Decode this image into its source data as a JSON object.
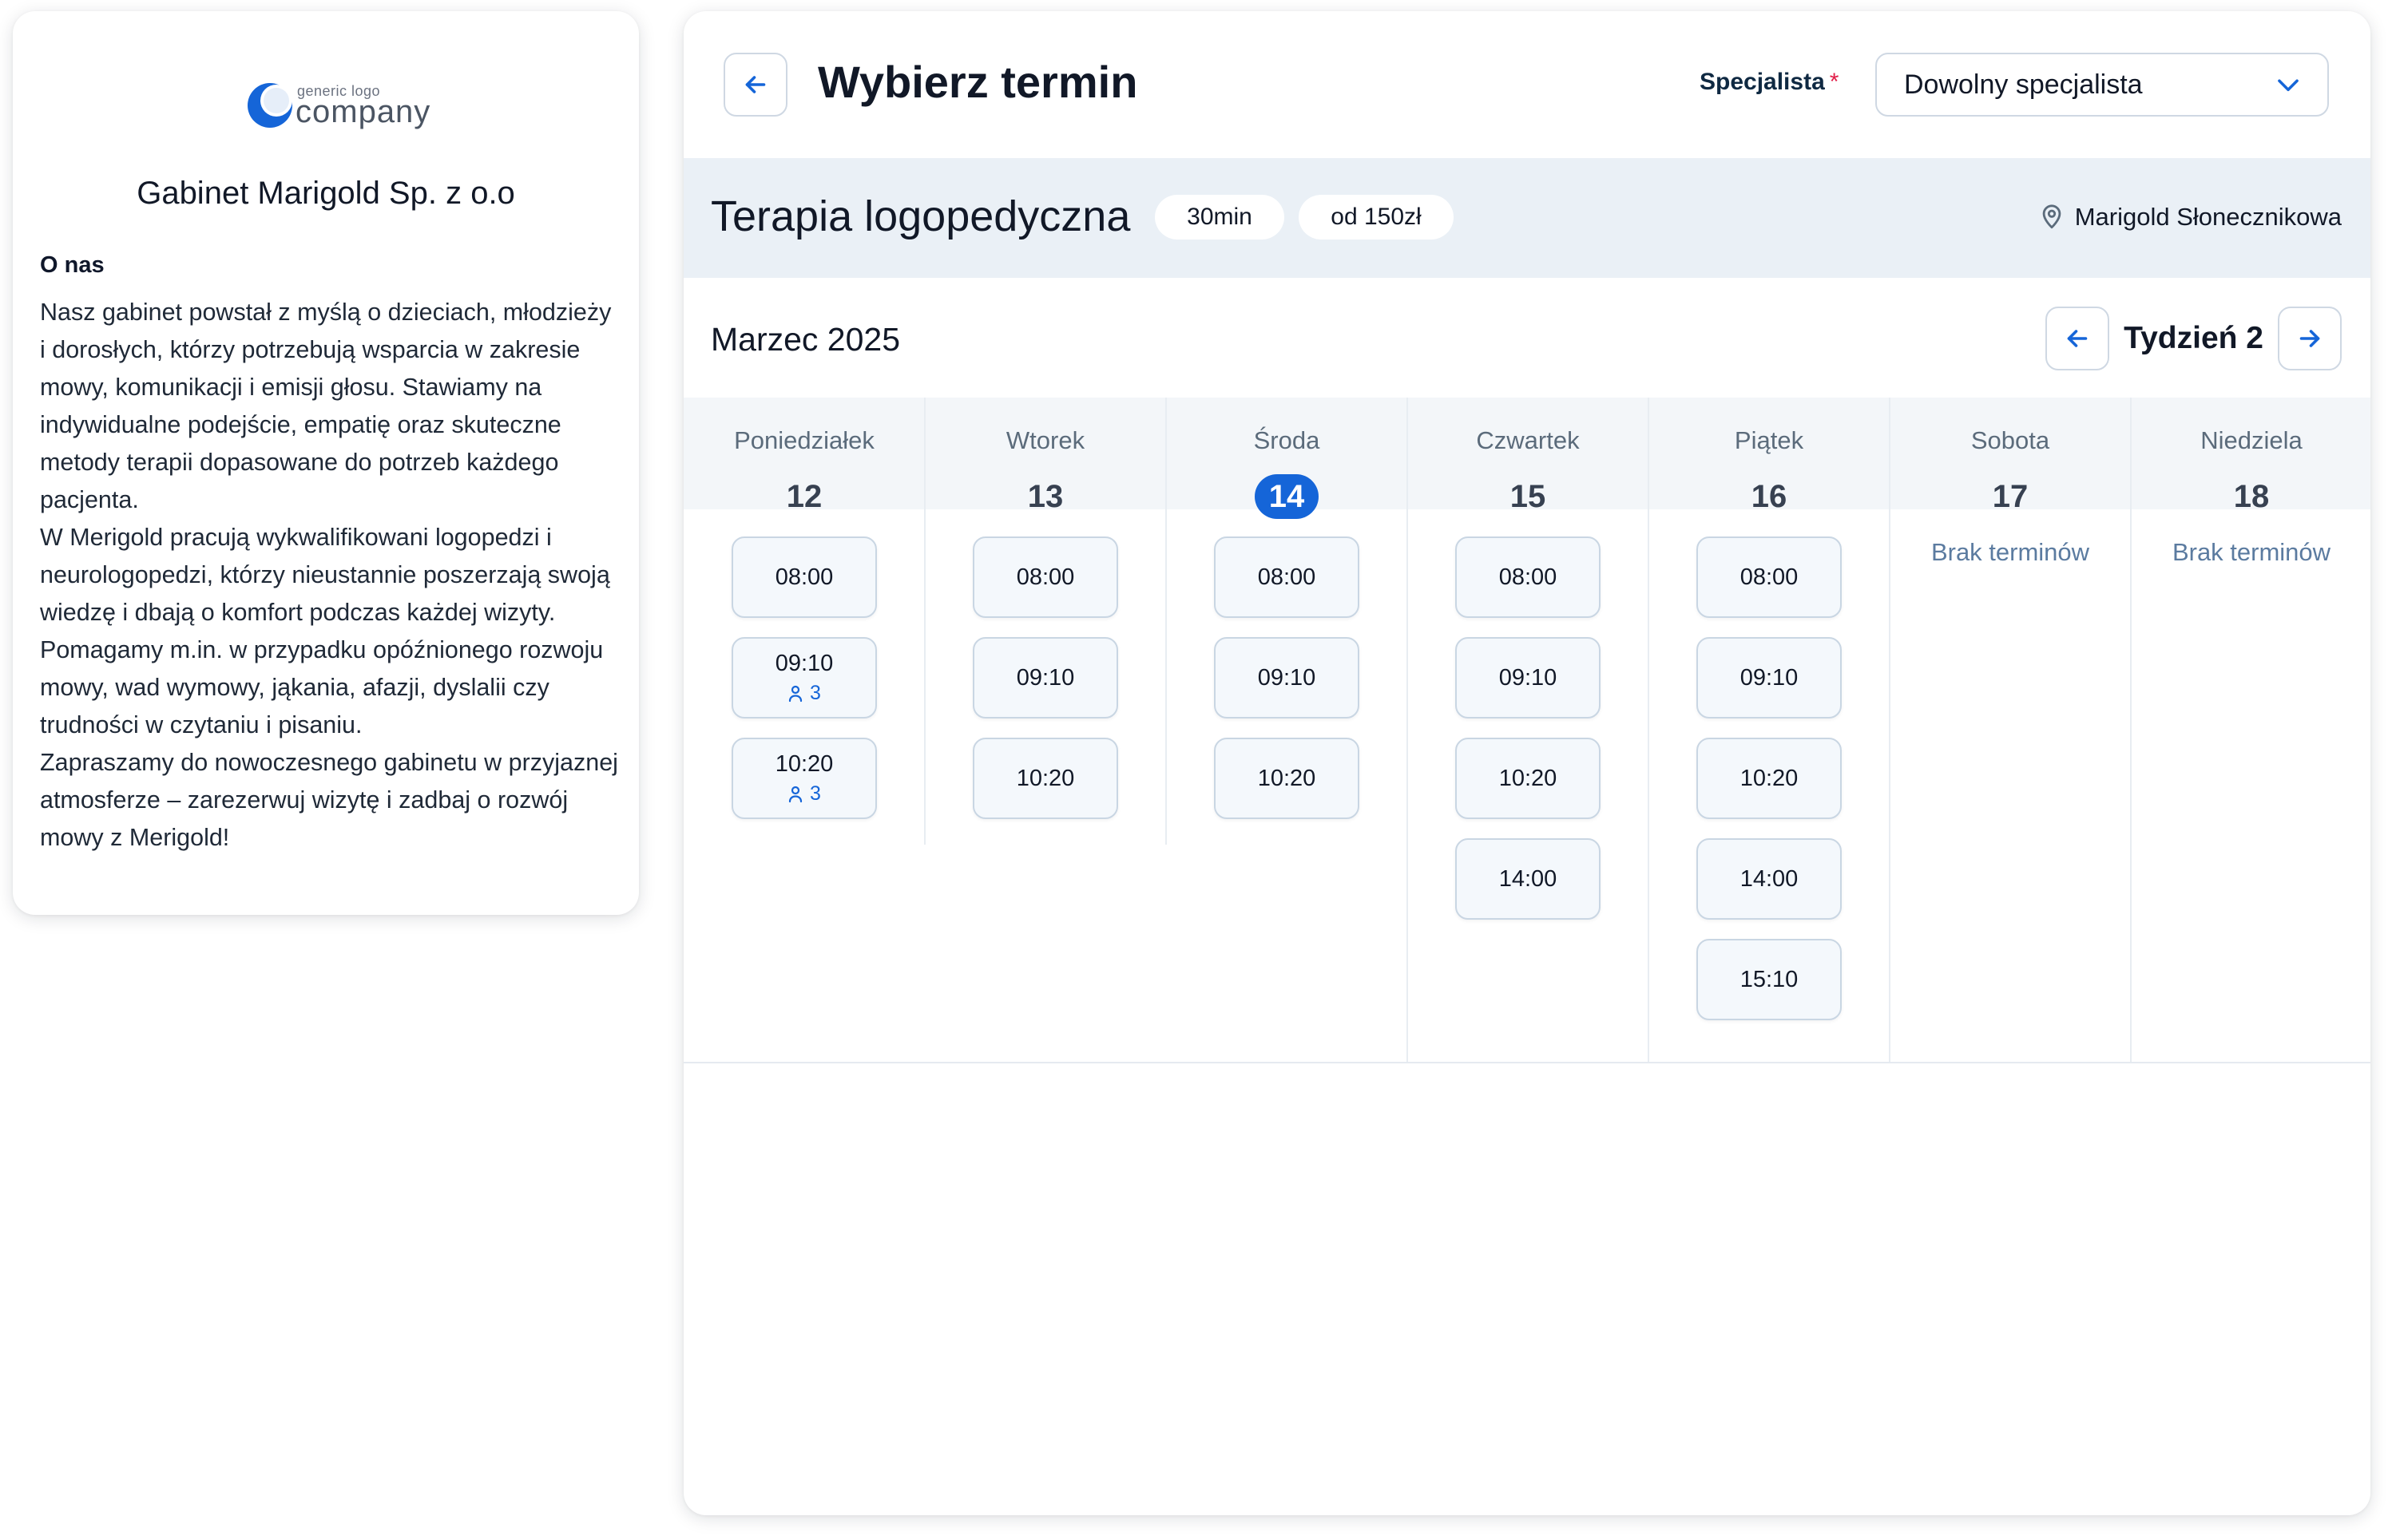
{
  "about": {
    "logo_small": "generic logo",
    "logo_text": "company",
    "company_name": "Gabinet Marigold Sp. z o.o",
    "heading": "O nas",
    "paragraphs": [
      "Nasz gabinet powstał z myślą o dzieciach, młodzieży i dorosłych, którzy potrzebują wsparcia w zakresie mowy, komunikacji i emisji głosu. Stawiamy na indywidualne podejście, empatię oraz skuteczne metody terapii dopasowane do potrzeb każdego pacjenta.",
      "W Merigold pracują wykwalifikowani logopedzi i neurologopedzi, którzy nieustannie poszerzają swoją wiedzę i dbają o komfort podczas każdej wizyty. Pomagamy m.in. w przypadku opóźnionego rozwoju mowy, wad wymowy, jąkania, afazji, dyslalii czy trudności w czytaniu i pisaniu.",
      "Zapraszamy do nowoczesnego gabinetu w przyjaznej atmosferze – zarezerwuj wizytę i zadbaj o rozwój mowy z Merigold!"
    ]
  },
  "header": {
    "title": "Wybierz termin",
    "back_icon": "arrow-left-icon",
    "specialist_label": "Specjalista",
    "required_mark": "*",
    "specialist_value": "Dowolny specjalista"
  },
  "service": {
    "name": "Terapia logopedyczna",
    "duration": "30min",
    "price": "od 150zł",
    "location": "Marigold Słonecznikowa"
  },
  "calendar": {
    "month": "Marzec 2025",
    "week_label": "Tydzień 2",
    "days": [
      {
        "name": "Poniedziałek",
        "num": "12",
        "today": false,
        "empty_text": "",
        "slots": [
          {
            "time": "08:00",
            "cap": ""
          },
          {
            "time": "09:10",
            "cap": "3"
          },
          {
            "time": "10:20",
            "cap": "3"
          }
        ]
      },
      {
        "name": "Wtorek",
        "num": "13",
        "today": false,
        "empty_text": "",
        "slots": [
          {
            "time": "08:00",
            "cap": ""
          },
          {
            "time": "09:10",
            "cap": ""
          },
          {
            "time": "10:20",
            "cap": ""
          }
        ]
      },
      {
        "name": "Środa",
        "num": "14",
        "today": true,
        "empty_text": "",
        "slots": [
          {
            "time": "08:00",
            "cap": ""
          },
          {
            "time": "09:10",
            "cap": ""
          },
          {
            "time": "10:20",
            "cap": ""
          }
        ]
      },
      {
        "name": "Czwartek",
        "num": "15",
        "today": false,
        "empty_text": "",
        "slots": [
          {
            "time": "08:00",
            "cap": ""
          },
          {
            "time": "09:10",
            "cap": ""
          },
          {
            "time": "10:20",
            "cap": ""
          },
          {
            "time": "14:00",
            "cap": ""
          }
        ]
      },
      {
        "name": "Piątek",
        "num": "16",
        "today": false,
        "empty_text": "",
        "slots": [
          {
            "time": "08:00",
            "cap": ""
          },
          {
            "time": "09:10",
            "cap": ""
          },
          {
            "time": "10:20",
            "cap": ""
          },
          {
            "time": "14:00",
            "cap": ""
          },
          {
            "time": "15:10",
            "cap": ""
          }
        ]
      },
      {
        "name": "Sobota",
        "num": "17",
        "today": false,
        "empty_text": "Brak terminów",
        "slots": []
      },
      {
        "name": "Niedziela",
        "num": "18",
        "today": false,
        "empty_text": "Brak terminów",
        "slots": []
      }
    ]
  },
  "colors": {
    "accent": "#1565d8",
    "service_bar": "#eaf0f6",
    "day_header": "#f3f6f9",
    "slot_bg": "#f4f8fc",
    "required": "#e11d48"
  }
}
